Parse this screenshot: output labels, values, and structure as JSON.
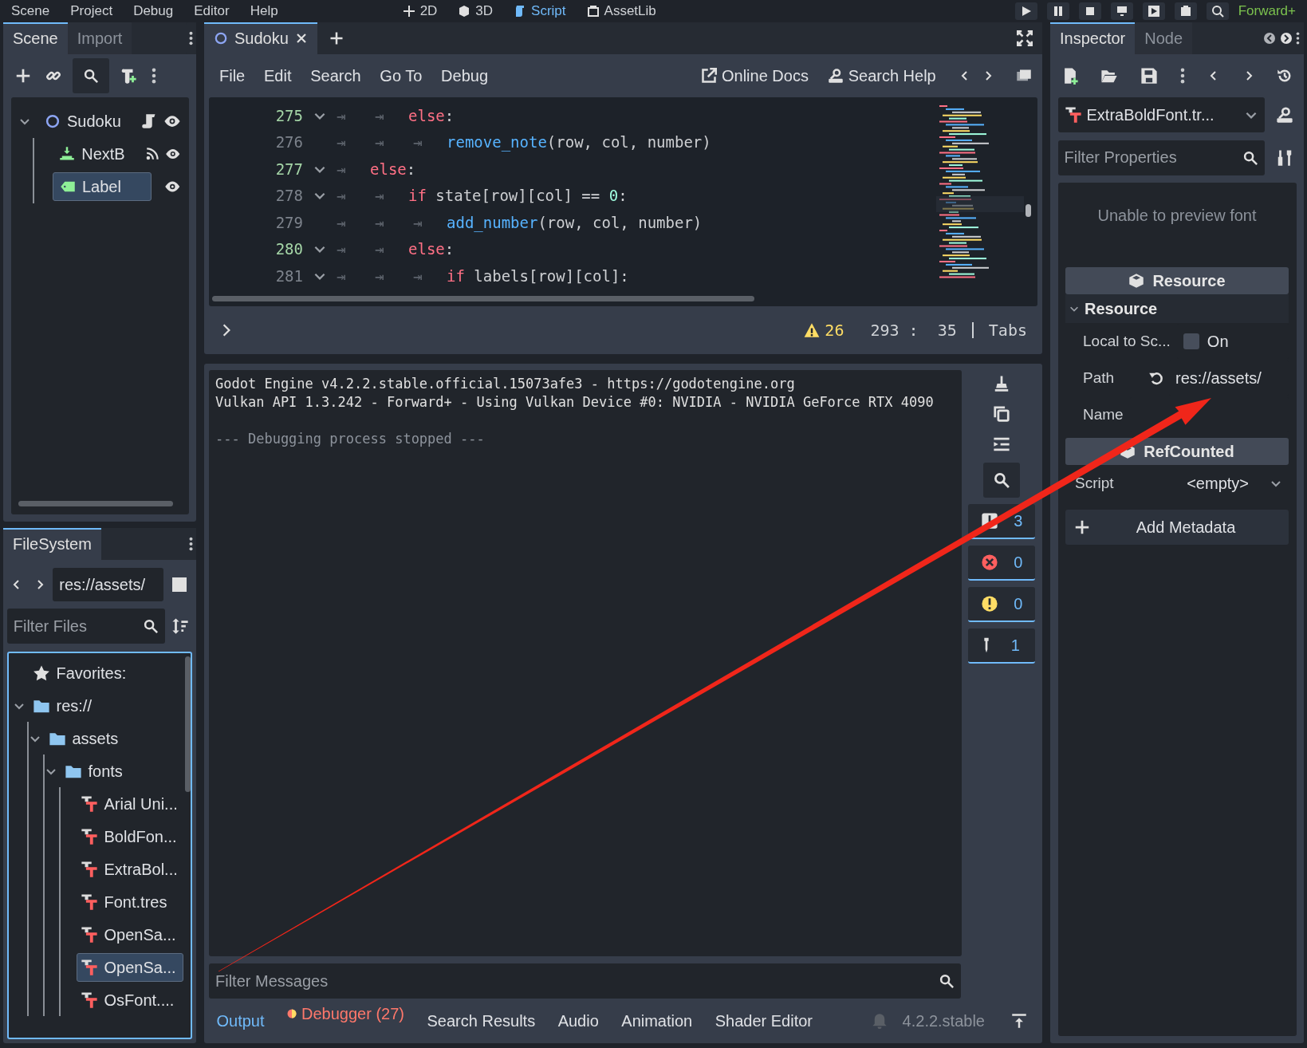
{
  "menu_bar": {
    "menus": [
      "Scene",
      "Project",
      "Debug",
      "Editor",
      "Help"
    ],
    "workspaces": [
      {
        "label": "2D",
        "kind": "canvas",
        "selected": false
      },
      {
        "label": "3D",
        "kind": "spatial",
        "selected": false
      },
      {
        "label": "Script",
        "kind": "script",
        "selected": true
      },
      {
        "label": "AssetLib",
        "kind": "assetlib",
        "selected": false
      }
    ],
    "renderer": "Forward+"
  },
  "scene_dock": {
    "tabs": [
      {
        "label": "Scene",
        "selected": true
      },
      {
        "label": "Import",
        "selected": false
      }
    ],
    "tree": [
      {
        "name": "Sudoku",
        "kind": "node2d",
        "selected": false,
        "expanded": true,
        "has_script": true,
        "has_signals": false,
        "visible": true,
        "children": [
          {
            "name": "NextB",
            "kind": "button",
            "selected": false,
            "has_script": false,
            "has_signals": true,
            "visible": true
          },
          {
            "name": "Label",
            "kind": "label",
            "selected": true,
            "has_script": false,
            "has_signals": false,
            "visible": true
          }
        ]
      }
    ]
  },
  "filesystem": {
    "tab": "FileSystem",
    "path": "res://assets/",
    "filter_placeholder": "Filter Files",
    "tree": [
      {
        "name": "Favorites:",
        "kind": "favorites",
        "selected": false
      },
      {
        "name": "res://",
        "kind": "folder",
        "expanded": true,
        "selected": false,
        "children": [
          {
            "name": "assets",
            "kind": "folder",
            "expanded": true,
            "selected": false,
            "children": [
              {
                "name": "fonts",
                "kind": "folder",
                "expanded": true,
                "selected": false,
                "children": [
                  {
                    "name": "Arial Uni...",
                    "kind": "font",
                    "selected": false
                  },
                  {
                    "name": "BoldFon...",
                    "kind": "font",
                    "selected": false
                  },
                  {
                    "name": "ExtraBol...",
                    "kind": "font",
                    "selected": false
                  },
                  {
                    "name": "Font.tres",
                    "kind": "font",
                    "selected": false
                  },
                  {
                    "name": "OpenSa...",
                    "kind": "font",
                    "selected": false
                  },
                  {
                    "name": "OpenSa...",
                    "kind": "font",
                    "selected": true
                  },
                  {
                    "name": "OsFont....",
                    "kind": "font",
                    "selected": false
                  }
                ]
              }
            ]
          }
        ]
      }
    ]
  },
  "script_editor": {
    "tabs": [
      {
        "label": "Sudoku",
        "selected": true
      }
    ],
    "menus": [
      "File",
      "Edit",
      "Search",
      "Go To",
      "Debug"
    ],
    "links": [
      "Online Docs",
      "Search Help"
    ],
    "code": [
      {
        "number": "275",
        "fold": true,
        "changed": true,
        "indent": [
          "⇥",
          "⇥"
        ],
        "tokens": [
          {
            "t": "else",
            "kind": "keyword"
          },
          {
            "t": ":",
            "kind": "plain"
          }
        ]
      },
      {
        "number": "276",
        "fold": false,
        "changed": false,
        "indent": [
          "⇥",
          "⇥",
          "⇥"
        ],
        "tokens": [
          {
            "t": "remove_note",
            "kind": "function"
          },
          {
            "t": "(row, col, number)",
            "kind": "plain"
          }
        ]
      },
      {
        "number": "277",
        "fold": true,
        "changed": true,
        "indent": [
          "⇥"
        ],
        "tokens": [
          {
            "t": "else",
            "kind": "keyword"
          },
          {
            "t": ":",
            "kind": "plain"
          }
        ]
      },
      {
        "number": "278",
        "fold": true,
        "changed": false,
        "indent": [
          "⇥",
          "⇥"
        ],
        "tokens": [
          {
            "t": "if",
            "kind": "keyword"
          },
          {
            "t": " state[row][col] == ",
            "kind": "plain"
          },
          {
            "t": "0",
            "kind": "number"
          },
          {
            "t": ":",
            "kind": "plain"
          }
        ]
      },
      {
        "number": "279",
        "fold": false,
        "changed": false,
        "indent": [
          "⇥",
          "⇥",
          "⇥"
        ],
        "tokens": [
          {
            "t": "add_number",
            "kind": "function"
          },
          {
            "t": "(row, col, number)",
            "kind": "plain"
          }
        ]
      },
      {
        "number": "280",
        "fold": true,
        "changed": true,
        "indent": [
          "⇥",
          "⇥"
        ],
        "tokens": [
          {
            "t": "else",
            "kind": "keyword"
          },
          {
            "t": ":",
            "kind": "plain"
          }
        ]
      },
      {
        "number": "281",
        "fold": true,
        "changed": false,
        "indent": [
          "⇥",
          "⇥",
          "⇥"
        ],
        "tokens": [
          {
            "t": "if",
            "kind": "keyword"
          },
          {
            "t": " labels[row][col]:",
            "kind": "plain"
          }
        ]
      }
    ],
    "warnings": "26",
    "position": "293 :  35",
    "indent": "Tabs"
  },
  "output": {
    "lines": [
      {
        "text": "Godot Engine v4.2.2.stable.official.15073afe3 - https://godotengine.org",
        "kind": "normal"
      },
      {
        "text": "Vulkan API 1.3.242 - Forward+ - Using Vulkan Device #0: NVIDIA - NVIDIA GeForce RTX 4090",
        "kind": "normal"
      },
      {
        "text": "--- Debugging process stopped ---",
        "kind": "dim"
      }
    ],
    "search_on": true,
    "filters": [
      {
        "kind": "message",
        "count": "3",
        "on": true
      },
      {
        "kind": "error",
        "count": "0",
        "on": true
      },
      {
        "kind": "warning",
        "count": "0",
        "on": true
      },
      {
        "kind": "editor",
        "count": "1",
        "on": true
      }
    ],
    "filter_placeholder": "Filter Messages"
  },
  "bottom_tabs": [
    {
      "label": "Output",
      "selected": true,
      "alert": false
    },
    {
      "label": "Debugger (27)",
      "selected": false,
      "alert": true
    },
    {
      "label": "Search Results",
      "selected": false,
      "alert": false
    },
    {
      "label": "Audio",
      "selected": false,
      "alert": false
    },
    {
      "label": "Animation",
      "selected": false,
      "alert": false
    },
    {
      "label": "Shader Editor",
      "selected": false,
      "alert": false
    }
  ],
  "version": "4.2.2.stable",
  "inspector": {
    "tabs": [
      {
        "label": "Inspector",
        "selected": true
      },
      {
        "label": "Node",
        "selected": false
      }
    ],
    "resource": "ExtraBoldFont.tr...",
    "filter_placeholder": "Filter Properties",
    "preview_message": "Unable to preview font",
    "properties": [
      {
        "kind": "category",
        "label": "Resource"
      },
      {
        "kind": "group",
        "label": "Resource",
        "expanded": true
      },
      {
        "kind": "checkbox",
        "label": "Local to Sc...",
        "value": "On",
        "checked": false
      },
      {
        "kind": "path",
        "label": "Path",
        "value": "res://assets/"
      },
      {
        "kind": "text",
        "label": "Name"
      },
      {
        "kind": "category",
        "label": "RefCounted"
      },
      {
        "kind": "resource",
        "label": "Script",
        "value": "<empty>"
      }
    ],
    "add_button": "Add Metadata"
  },
  "annotation": {
    "kind": "arrow"
  }
}
